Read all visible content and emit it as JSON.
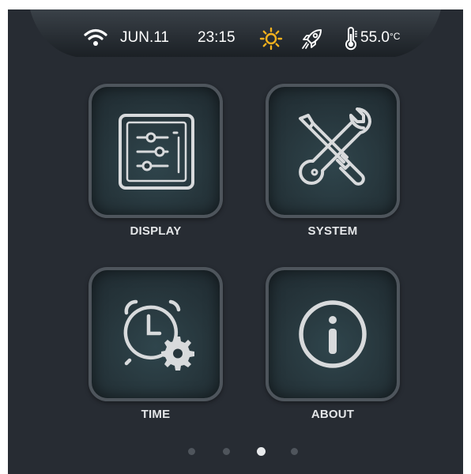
{
  "status_bar": {
    "date": "JUN.11",
    "time": "23:15",
    "temperature": "55.0",
    "temperature_unit": "°C",
    "icons": [
      "wifi-icon",
      "sun-icon",
      "rocket-icon",
      "thermometer-icon"
    ]
  },
  "apps": [
    {
      "label": "DISPLAY",
      "icon": "sliders-icon"
    },
    {
      "label": "SYSTEM",
      "icon": "tools-icon"
    },
    {
      "label": "TIME",
      "icon": "alarm-clock-settings-icon"
    },
    {
      "label": "ABOUT",
      "icon": "info-icon"
    }
  ],
  "pagination": {
    "total_pages": 4,
    "active_page": 3
  },
  "colors": {
    "background": "#272c33",
    "accent_sun": "#f5b21e",
    "icon_light": "#d8dadc",
    "tile_border": "#4e555c"
  }
}
